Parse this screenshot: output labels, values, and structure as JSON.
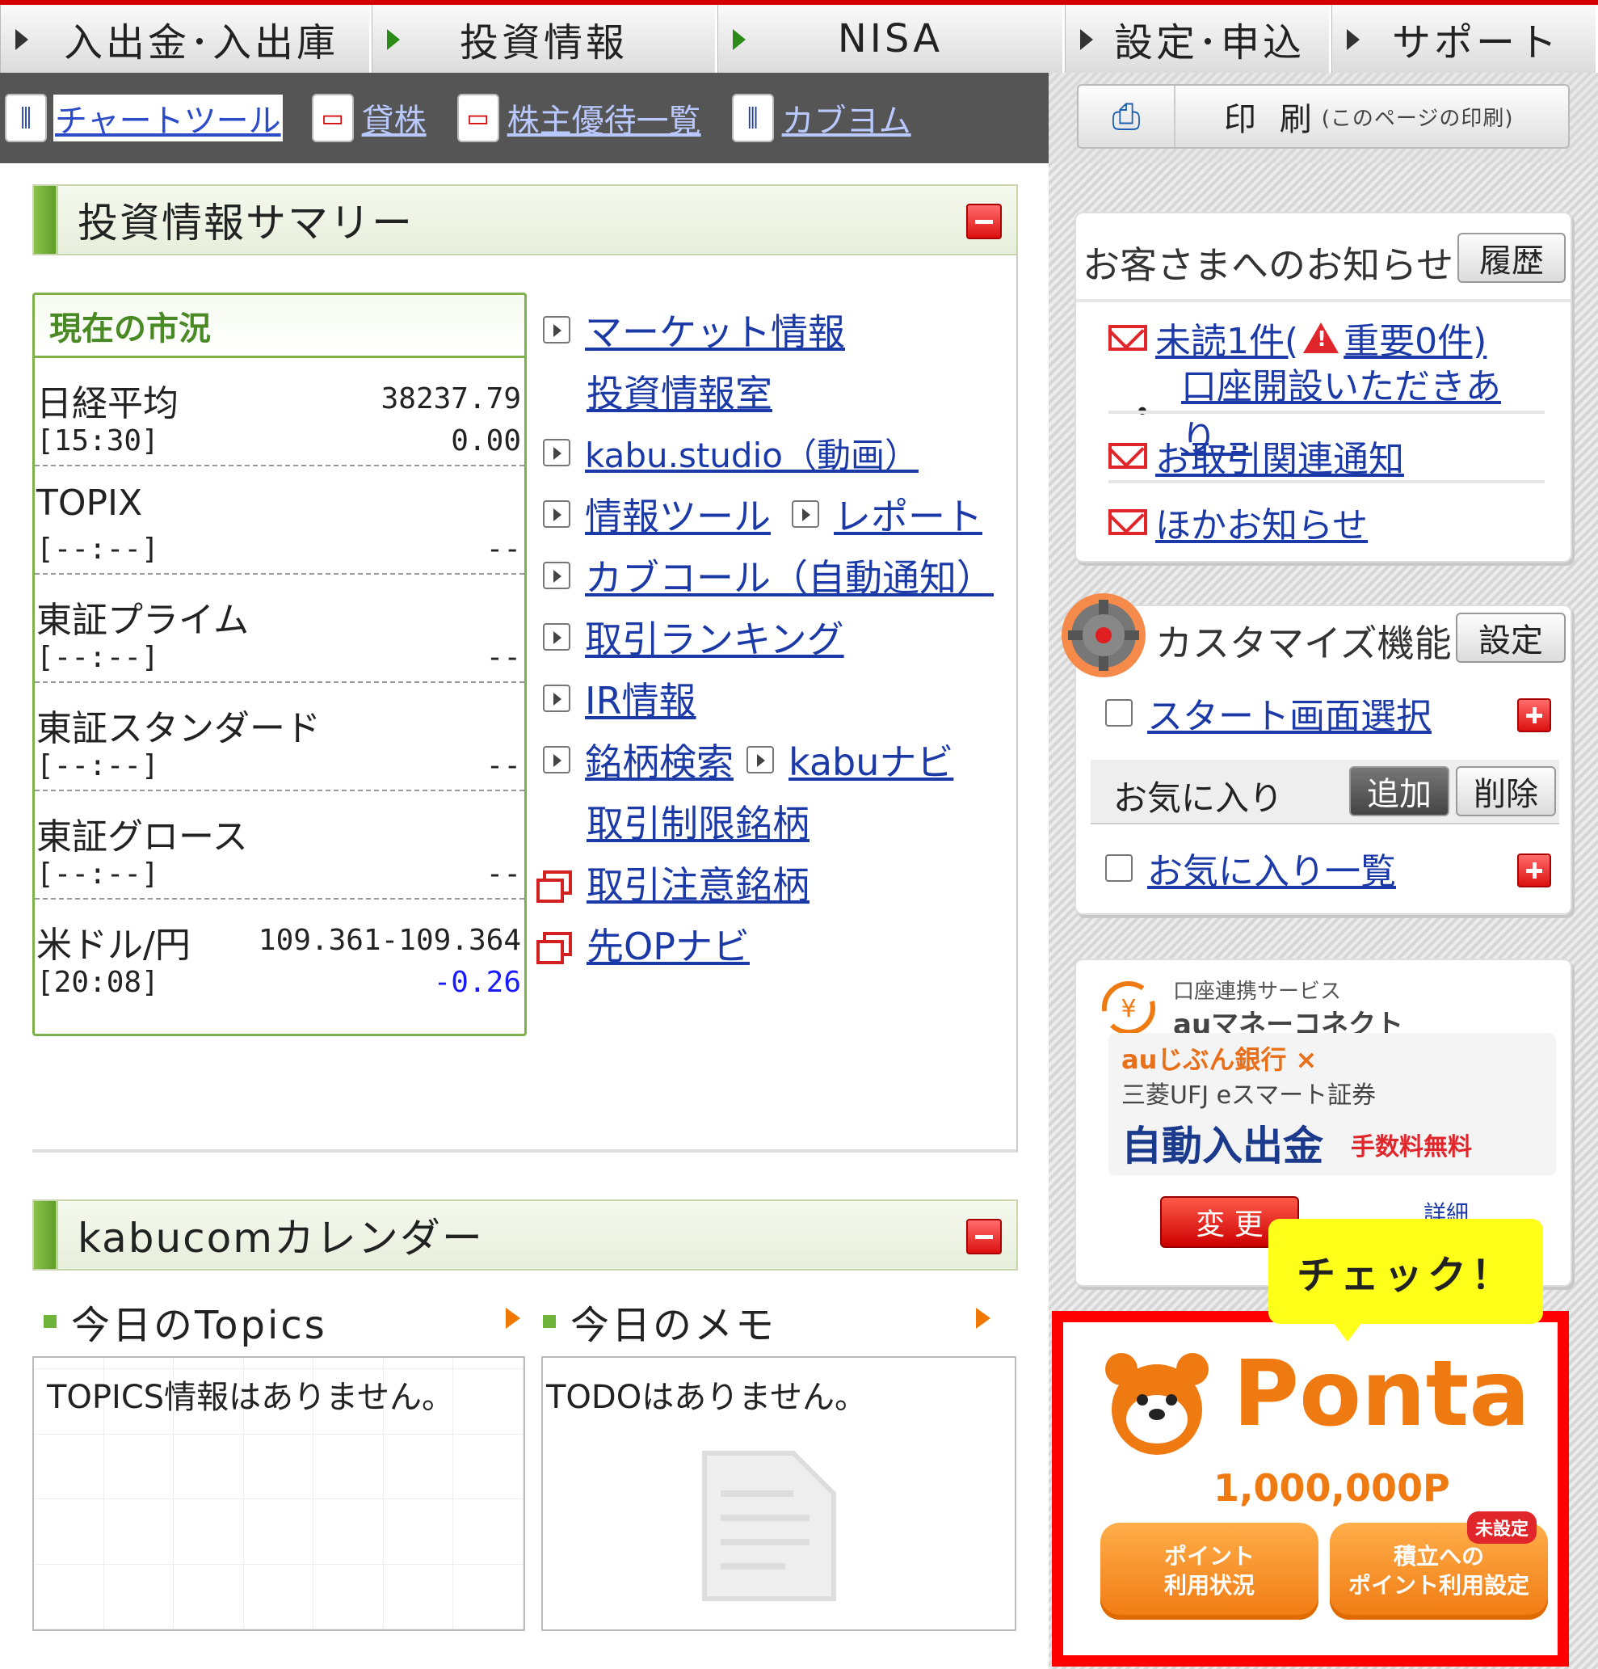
{
  "nav": {
    "tabs": [
      "入出金･入出庫",
      "投資情報",
      "NISA",
      "設定･申込",
      "サポート"
    ]
  },
  "toolbar": {
    "items": [
      "チャートツール",
      "貸株",
      "株主優待一覧",
      "カブヨム"
    ],
    "print_label": "印 刷",
    "print_sub": "(このページの印刷)"
  },
  "summary": {
    "title": "投資情報サマリー",
    "market_title": "現在の市況",
    "market": [
      {
        "name": "日経平均",
        "value": "38237.79",
        "time": "[15:30]",
        "change": "0.00"
      },
      {
        "name": "TOPIX",
        "value": "",
        "time": "[--:--]",
        "change": "--"
      },
      {
        "name": "東証プライム",
        "value": "",
        "time": "[--:--]",
        "change": "--"
      },
      {
        "name": "東証スタンダード",
        "value": "",
        "time": "[--:--]",
        "change": "--"
      },
      {
        "name": "東証グロース",
        "value": "",
        "time": "[--:--]",
        "change": "--"
      },
      {
        "name": "米ドル/円",
        "value": "109.361-109.364",
        "time": "[20:08]",
        "change": "-0.26"
      }
    ],
    "links": {
      "market_info": "マーケット情報",
      "invest_room": "投資情報室",
      "kabu_studio": "kabu.studio（動画）",
      "info_tools": "情報ツール",
      "report": "レポート",
      "kabucall": "カブコール（自動通知）",
      "ranking": "取引ランキング",
      "ir": "IR情報",
      "search": "銘柄検索",
      "kabunavi": "kabuナビ",
      "restricted": "取引制限銘柄",
      "caution": "取引注意銘柄",
      "opnavi": "先OPナビ"
    }
  },
  "calendar": {
    "title": "kabucomカレンダー",
    "topics_title": "今日のTopics",
    "memo_title": "今日のメモ",
    "topics_empty": "TOPICS情報はありません。",
    "memo_empty": "TODOはありません。"
  },
  "notices": {
    "title": "お客さまへのお知らせ",
    "history_button": "履歴",
    "unread_a": "未読1件(",
    "unread_b": "重要0件)",
    "bullet": "・",
    "account_msg": "口座開設いただきあり…",
    "trade_notice": "お取引関連通知",
    "other_notice": "ほかお知らせ"
  },
  "customize": {
    "title": "カスタマイズ機能",
    "setting_button": "設定",
    "start_screen": "スタート画面選択",
    "favorites_label": "お気に入り",
    "add_button": "追加",
    "delete_button": "削除",
    "favorites_list": "お気に入り一覧"
  },
  "au": {
    "service": "口座連携サービス",
    "name": "auマネーコネクト",
    "bank": "auじぶん銀行 ×",
    "securities": "三菱UFJ eスマート証券",
    "auto": "自動入出金",
    "free": "手数料無料",
    "change_button": "変 更",
    "detail": "詳細"
  },
  "ponta": {
    "check": "チェック！",
    "brand": "Ponta",
    "points": "1,000,000P",
    "btn_usage": "ポイント\n利用状況",
    "btn_setting": "積立への\nポイント利用設定",
    "badge": "未設定"
  }
}
